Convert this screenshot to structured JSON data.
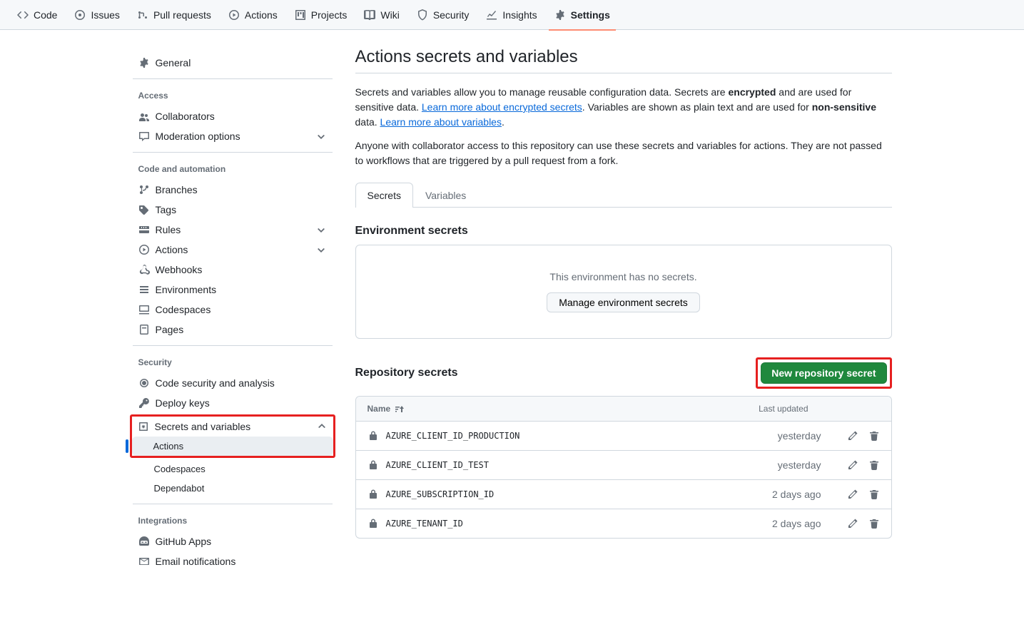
{
  "topnav": [
    {
      "label": "Code"
    },
    {
      "label": "Issues"
    },
    {
      "label": "Pull requests"
    },
    {
      "label": "Actions"
    },
    {
      "label": "Projects"
    },
    {
      "label": "Wiki"
    },
    {
      "label": "Security"
    },
    {
      "label": "Insights"
    },
    {
      "label": "Settings"
    }
  ],
  "sidebar": {
    "general": "General",
    "access_heading": "Access",
    "access_items": [
      "Collaborators",
      "Moderation options"
    ],
    "code_heading": "Code and automation",
    "code_items": [
      "Branches",
      "Tags",
      "Rules",
      "Actions",
      "Webhooks",
      "Environments",
      "Codespaces",
      "Pages"
    ],
    "security_heading": "Security",
    "security_items": [
      "Code security and analysis",
      "Deploy keys",
      "Secrets and variables"
    ],
    "secrets_sub": [
      "Actions",
      "Codespaces",
      "Dependabot"
    ],
    "integrations_heading": "Integrations",
    "integrations_items": [
      "GitHub Apps",
      "Email notifications"
    ]
  },
  "page": {
    "title": "Actions secrets and variables",
    "intro_1a": "Secrets and variables allow you to manage reusable configuration data. Secrets are ",
    "intro_1b": "encrypted",
    "intro_1c": " and are used for sensitive data. ",
    "link_secrets": "Learn more about encrypted secrets",
    "intro_1d": ". Variables are shown as plain text and are used for ",
    "intro_1e": "non-sensitive",
    "intro_1f": " data. ",
    "link_vars": "Learn more about variables",
    "intro_1g": ".",
    "intro_2": "Anyone with collaborator access to this repository can use these secrets and variables for actions. They are not passed to workflows that are triggered by a pull request from a fork.",
    "tab_secrets": "Secrets",
    "tab_variables": "Variables",
    "env_heading": "Environment secrets",
    "env_empty": "This environment has no secrets.",
    "env_button": "Manage environment secrets",
    "repo_heading": "Repository secrets",
    "new_secret_button": "New repository secret",
    "col_name": "Name",
    "col_updated": "Last updated"
  },
  "secrets": [
    {
      "name": "AZURE_CLIENT_ID_PRODUCTION",
      "updated": "yesterday"
    },
    {
      "name": "AZURE_CLIENT_ID_TEST",
      "updated": "yesterday"
    },
    {
      "name": "AZURE_SUBSCRIPTION_ID",
      "updated": "2 days ago"
    },
    {
      "name": "AZURE_TENANT_ID",
      "updated": "2 days ago"
    }
  ]
}
